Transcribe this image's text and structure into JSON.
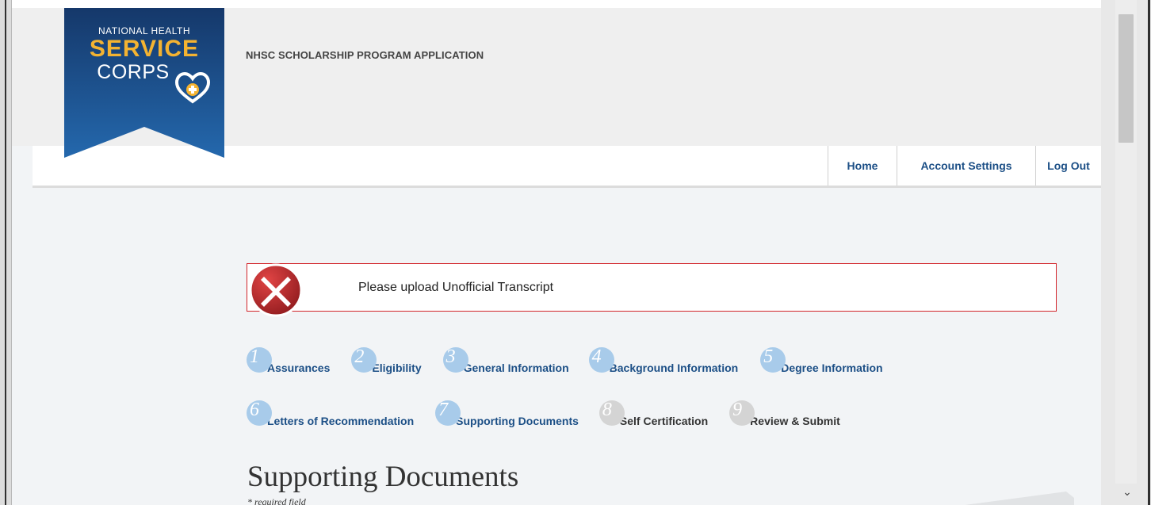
{
  "logo": {
    "line1": "NATIONAL HEALTH",
    "line2": "SERVICE",
    "line3": "CORPS",
    "colors": {
      "banner": "#1e4e8c",
      "accent": "#f4b331"
    }
  },
  "header": {
    "title": "NHSC SCHOLARSHIP PROGRAM APPLICATION"
  },
  "nav": {
    "home": "Home",
    "account_settings": "Account Settings",
    "log_out": "Log Out"
  },
  "alert": {
    "message": "Please upload Unofficial Transcript",
    "icon": "error-x-icon",
    "border_color": "#d2242a"
  },
  "steps": [
    {
      "num": "1",
      "label": "Assurances",
      "status": "active"
    },
    {
      "num": "2",
      "label": "Eligibility",
      "status": "active"
    },
    {
      "num": "3",
      "label": "General Information",
      "status": "active"
    },
    {
      "num": "4",
      "label": "Background Information",
      "status": "active"
    },
    {
      "num": "5",
      "label": "Degree Information",
      "status": "active"
    },
    {
      "num": "6",
      "label": "Letters of Recommendation",
      "status": "active"
    },
    {
      "num": "7",
      "label": "Supporting Documents",
      "status": "active"
    },
    {
      "num": "8",
      "label": "Self Certification",
      "status": "inactive"
    },
    {
      "num": "9",
      "label": "Review & Submit",
      "status": "inactive"
    }
  ],
  "section": {
    "title": "Supporting Documents",
    "required_note": "* required field"
  },
  "scrollbar": {
    "arrow_icon": "chevron-down-icon"
  }
}
